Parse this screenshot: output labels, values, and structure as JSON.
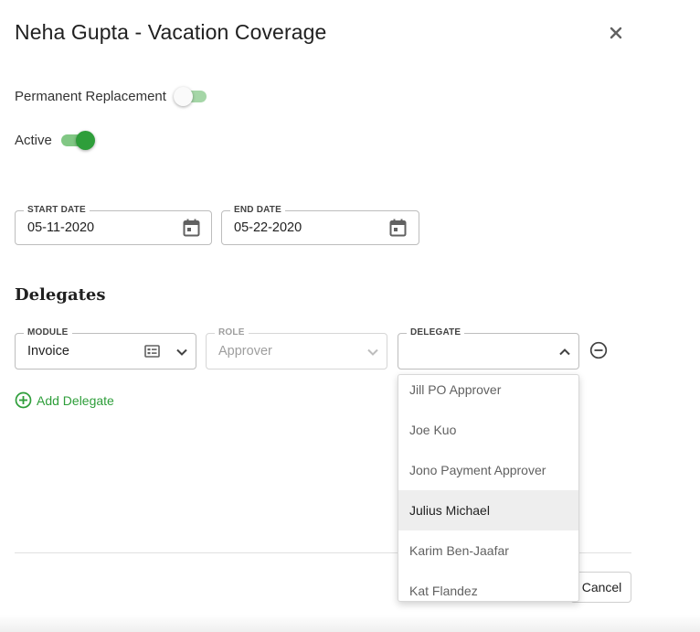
{
  "dialog": {
    "title": "Neha Gupta - Vacation Coverage",
    "close_icon": "close-icon"
  },
  "toggles": {
    "permanent_replacement": {
      "label": "Permanent Replacement",
      "on": false
    },
    "active": {
      "label": "Active",
      "on": true
    }
  },
  "dates": {
    "start": {
      "label": "START DATE",
      "value": "05-11-2020",
      "icon": "calendar-icon"
    },
    "end": {
      "label": "END DATE",
      "value": "05-22-2020",
      "icon": "calendar-icon"
    }
  },
  "delegates": {
    "title": "Delegates",
    "module": {
      "label": "MODULE",
      "value": "Invoice",
      "icon": "list-icon"
    },
    "role": {
      "label": "ROLE",
      "value": "Approver"
    },
    "delegate": {
      "label": "DELEGATE",
      "value": ""
    },
    "add_label": "Add Delegate",
    "options": [
      "Jill PO Approver",
      "Joe Kuo",
      "Jono Payment Approver",
      "Julius Michael",
      "Karim Ben-Jaafar",
      "Kat Flandez"
    ],
    "highlighted": "Julius Michael"
  },
  "footer": {
    "cancel_label": "Cancel"
  },
  "colors": {
    "accent": "#2e9e3a",
    "toggle_track": "#81c784",
    "border": "#bdbdbd"
  }
}
